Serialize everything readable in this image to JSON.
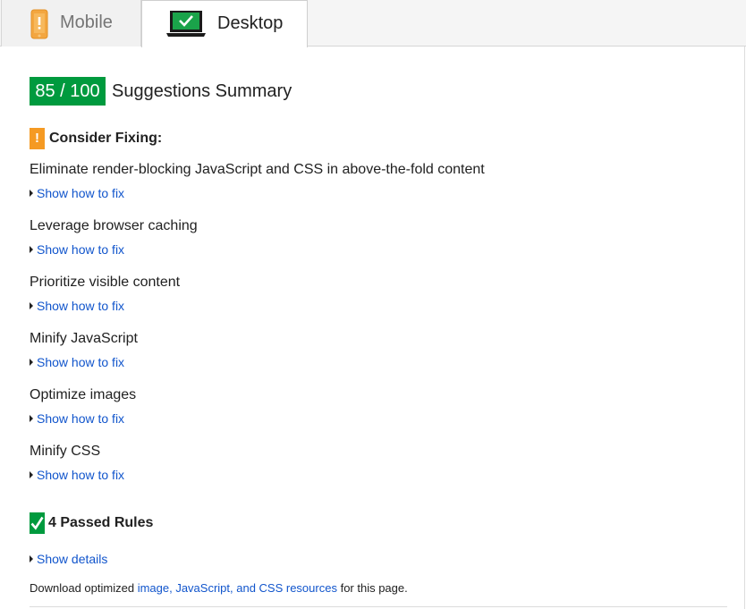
{
  "tabs": {
    "mobile_label": "Mobile",
    "desktop_label": "Desktop",
    "mobile_icon": "phone-warning-icon",
    "desktop_icon": "laptop-check-icon"
  },
  "summary": {
    "score": "85 / 100",
    "title": "Suggestions Summary",
    "score_color": "#009a3e"
  },
  "consider": {
    "icon_symbol": "!",
    "title": "Consider Fixing:",
    "warn_color": "#f59a23"
  },
  "rules": [
    {
      "title": "Eliminate render-blocking JavaScript and CSS in above-the-fold content",
      "link": "Show how to fix"
    },
    {
      "title": "Leverage browser caching",
      "link": "Show how to fix"
    },
    {
      "title": "Prioritize visible content",
      "link": "Show how to fix"
    },
    {
      "title": "Minify JavaScript",
      "link": "Show how to fix"
    },
    {
      "title": "Optimize images",
      "link": "Show how to fix"
    },
    {
      "title": "Minify CSS",
      "link": "Show how to fix"
    }
  ],
  "passed": {
    "title": "4 Passed Rules",
    "link": "Show details"
  },
  "download": {
    "prefix": "Download optimized ",
    "link": "image, JavaScript, and CSS resources",
    "suffix": " for this page."
  },
  "link_color": "#1155cc"
}
